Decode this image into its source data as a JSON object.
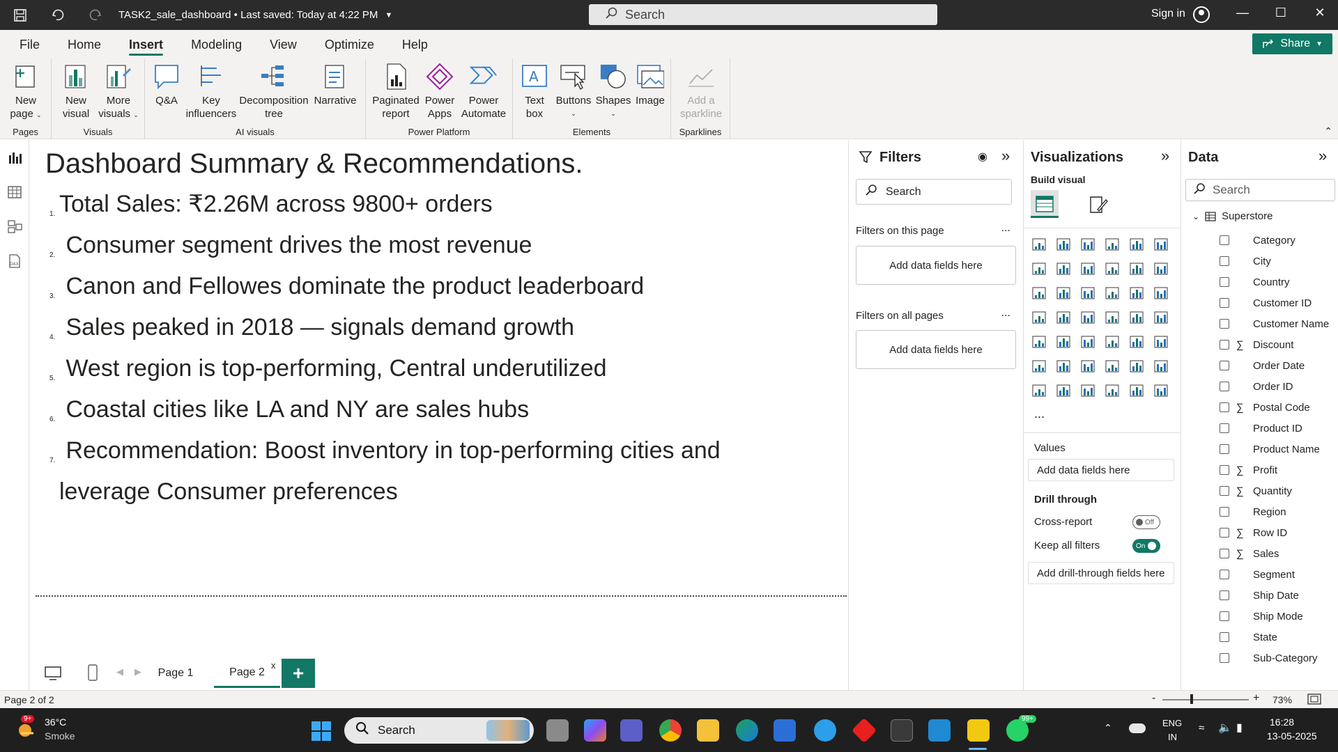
{
  "titlebar": {
    "document_title": "TASK2_sale_dashboard • Last saved: Today at 4:22 PM",
    "search_placeholder": "Search",
    "sign_in": "Sign in"
  },
  "menu": {
    "items": [
      "File",
      "Home",
      "Insert",
      "Modeling",
      "View",
      "Optimize",
      "Help"
    ],
    "active": "Insert",
    "share_label": "Share"
  },
  "ribbon": {
    "groups": [
      {
        "label": "Pages",
        "buttons": [
          "New\npage",
          ""
        ]
      },
      {
        "label": "Visuals"
      },
      {
        "label": "AI visuals"
      },
      {
        "label": "Power Platform"
      },
      {
        "label": "Elements"
      },
      {
        "label": "Sparklines"
      }
    ],
    "btn_new_page_1": "New",
    "btn_new_page_2": "page",
    "btn_new_visual_1": "New",
    "btn_new_visual_2": "visual",
    "btn_more_visuals_1": "More",
    "btn_more_visuals_2": "visuals",
    "btn_qa": "Q&A",
    "btn_key_infl_1": "Key",
    "btn_key_infl_2": "influencers",
    "btn_decomp_1": "Decomposition",
    "btn_decomp_2": "tree",
    "btn_narrative": "Narrative",
    "btn_paginated_1": "Paginated",
    "btn_paginated_2": "report",
    "btn_power_apps_1": "Power",
    "btn_power_apps_2": "Apps",
    "btn_power_automate_1": "Power",
    "btn_power_automate_2": "Automate",
    "btn_textbox_1": "Text",
    "btn_textbox_2": "box",
    "btn_buttons": "Buttons",
    "btn_shapes": "Shapes",
    "btn_image": "Image",
    "btn_sparkline_1": "Add a",
    "btn_sparkline_2": "sparkline",
    "group_pages": "Pages",
    "group_visuals": "Visuals",
    "group_ai": "AI visuals",
    "group_power": "Power Platform",
    "group_elements": "Elements",
    "group_sparklines": "Sparklines"
  },
  "report": {
    "title": "Dashboard Summary & Recommendations.",
    "items": [
      {
        "num": "1.",
        "text": "Total Sales: ₹2.26M across 9800+ orders"
      },
      {
        "num": "2.",
        "text": " Consumer segment drives the most revenue"
      },
      {
        "num": "3.",
        "text": " Canon and Fellowes dominate the product leaderboard"
      },
      {
        "num": "4.",
        "text": " Sales peaked in 2018 — signals demand growth"
      },
      {
        "num": "5.",
        "text": " West region is top-performing, Central underutilized"
      },
      {
        "num": "6.",
        "text": " Coastal cities like LA and NY are sales hubs"
      },
      {
        "num": "7.",
        "text": " Recommendation: Boost inventory in top-performing cities and"
      }
    ],
    "item7_cont": "leverage Consumer preferences"
  },
  "pages": {
    "tabs": [
      "Page 1",
      "Page 2"
    ],
    "active": "Page 2",
    "close_glyph": "x",
    "add_glyph": "+"
  },
  "filters": {
    "title": "Filters",
    "search_placeholder": "Search",
    "on_this_page": "Filters on this page",
    "on_all_pages": "Filters on all pages",
    "add_fields": "Add data fields here",
    "more": "..."
  },
  "visualizations": {
    "title": "Visualizations",
    "build_visual": "Build visual",
    "values_label": "Values",
    "values_placeholder": "Add data fields here",
    "drill_through": "Drill through",
    "cross_report": "Cross-report",
    "cross_report_state": "Off",
    "keep_all_filters": "Keep all filters",
    "keep_all_filters_state": "On",
    "drill_placeholder": "Add drill-through fields here",
    "more": "..."
  },
  "data": {
    "title": "Data",
    "search_placeholder": "Search",
    "table": "Superstore",
    "fields": [
      {
        "name": "Category",
        "sum": false
      },
      {
        "name": "City",
        "sum": false
      },
      {
        "name": "Country",
        "sum": false
      },
      {
        "name": "Customer ID",
        "sum": false
      },
      {
        "name": "Customer Name",
        "sum": false
      },
      {
        "name": "Discount",
        "sum": true
      },
      {
        "name": "Order Date",
        "sum": false
      },
      {
        "name": "Order ID",
        "sum": false
      },
      {
        "name": "Postal Code",
        "sum": true
      },
      {
        "name": "Product ID",
        "sum": false
      },
      {
        "name": "Product Name",
        "sum": false
      },
      {
        "name": "Profit",
        "sum": true
      },
      {
        "name": "Quantity",
        "sum": true
      },
      {
        "name": "Region",
        "sum": false
      },
      {
        "name": "Row ID",
        "sum": true
      },
      {
        "name": "Sales",
        "sum": true
      },
      {
        "name": "Segment",
        "sum": false
      },
      {
        "name": "Ship Date",
        "sum": false
      },
      {
        "name": "Ship Mode",
        "sum": false
      },
      {
        "name": "State",
        "sum": false
      },
      {
        "name": "Sub-Category",
        "sum": false
      }
    ]
  },
  "status": {
    "page_info": "Page 2 of 2",
    "zoom": "73%",
    "zoom_minus": "-",
    "zoom_plus": "+"
  },
  "taskbar": {
    "weather_temp": "36°C",
    "weather_desc": "Smoke",
    "weather_badge": "9+",
    "search_placeholder": "Search",
    "whatsapp_badge": "99+",
    "lang_1": "ENG",
    "lang_2": "IN",
    "time": "16:28",
    "date": "13-05-2025"
  },
  "colors": {
    "accent": "#117865",
    "titlebar": "#2b2b2b",
    "ribbon": "#f3f2f1",
    "taskbar": "#1f1f1f"
  }
}
